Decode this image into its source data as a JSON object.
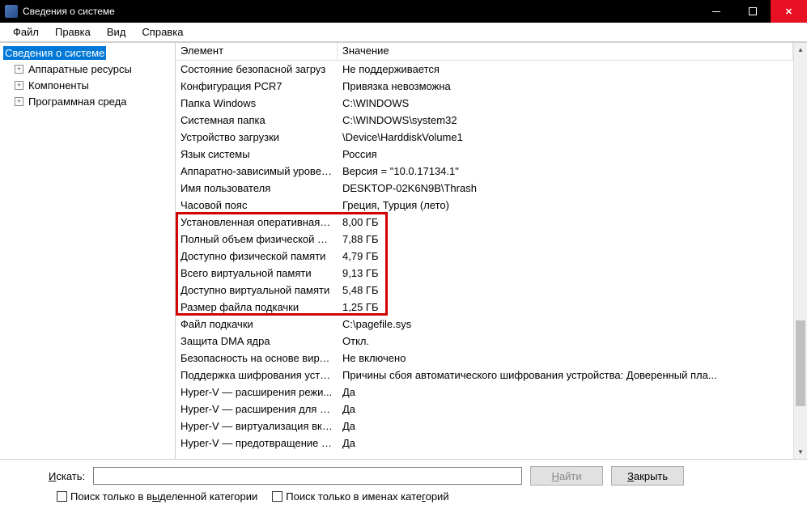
{
  "window": {
    "title": "Сведения о системе"
  },
  "menu": {
    "items": [
      "Файл",
      "Правка",
      "Вид",
      "Справка"
    ]
  },
  "tree": {
    "root": "Сведения о системе",
    "children": [
      "Аппаратные ресурсы",
      "Компоненты",
      "Программная среда"
    ]
  },
  "list": {
    "headers": {
      "element": "Элемент",
      "value": "Значение"
    },
    "rows": [
      {
        "element": "Состояние безопасной загруз",
        "value": "Не поддерживается"
      },
      {
        "element": "Конфигурация PCR7",
        "value": "Привязка невозможна"
      },
      {
        "element": "Папка Windows",
        "value": "C:\\WINDOWS"
      },
      {
        "element": "Системная папка",
        "value": "C:\\WINDOWS\\system32"
      },
      {
        "element": "Устройство загрузки",
        "value": "\\Device\\HarddiskVolume1"
      },
      {
        "element": "Язык системы",
        "value": "Россия"
      },
      {
        "element": "Аппаратно-зависимый уровен...",
        "value": "Версия = \"10.0.17134.1\""
      },
      {
        "element": "Имя пользователя",
        "value": "DESKTOP-02K6N9B\\Thrash"
      },
      {
        "element": "Часовой пояс",
        "value": "Греция, Турция (лето)"
      },
      {
        "element": "Установленная оперативная п...",
        "value": "8,00 ГБ"
      },
      {
        "element": "Полный объем физической па...",
        "value": "7,88 ГБ"
      },
      {
        "element": "Доступно физической памяти",
        "value": "4,79 ГБ"
      },
      {
        "element": "Всего виртуальной памяти",
        "value": "9,13 ГБ"
      },
      {
        "element": "Доступно виртуальной памяти",
        "value": "5,48 ГБ"
      },
      {
        "element": "Размер файла подкачки",
        "value": "1,25 ГБ"
      },
      {
        "element": "Файл подкачки",
        "value": "C:\\pagefile.sys"
      },
      {
        "element": "Защита DMA ядра",
        "value": "Откл."
      },
      {
        "element": "Безопасность на основе вирту...",
        "value": "Не включено"
      },
      {
        "element": "Поддержка шифрования устр...",
        "value": "Причины сбоя автоматического шифрования устройства: Доверенный пла..."
      },
      {
        "element": "Hyper-V — расширения режи...",
        "value": "Да"
      },
      {
        "element": "Hyper-V — расширения для п...",
        "value": "Да"
      },
      {
        "element": "Hyper-V — виртуализация вкл...",
        "value": "Да"
      },
      {
        "element": "Hyper-V — предотвращение в...",
        "value": "Да"
      }
    ],
    "highlight": {
      "startRow": 9,
      "endRow": 14
    }
  },
  "search": {
    "label_prefix": "И",
    "label_rest": "скать:",
    "find_prefix": "Н",
    "find_rest": "айти",
    "close_prefix": "З",
    "close_rest": "акрыть",
    "chk1_pre": "Поиск только в в",
    "chk1_ul": "ы",
    "chk1_post": "деленной категории",
    "chk2_pre": "Поиск только в именах кате",
    "chk2_ul": "г",
    "chk2_post": "орий"
  }
}
